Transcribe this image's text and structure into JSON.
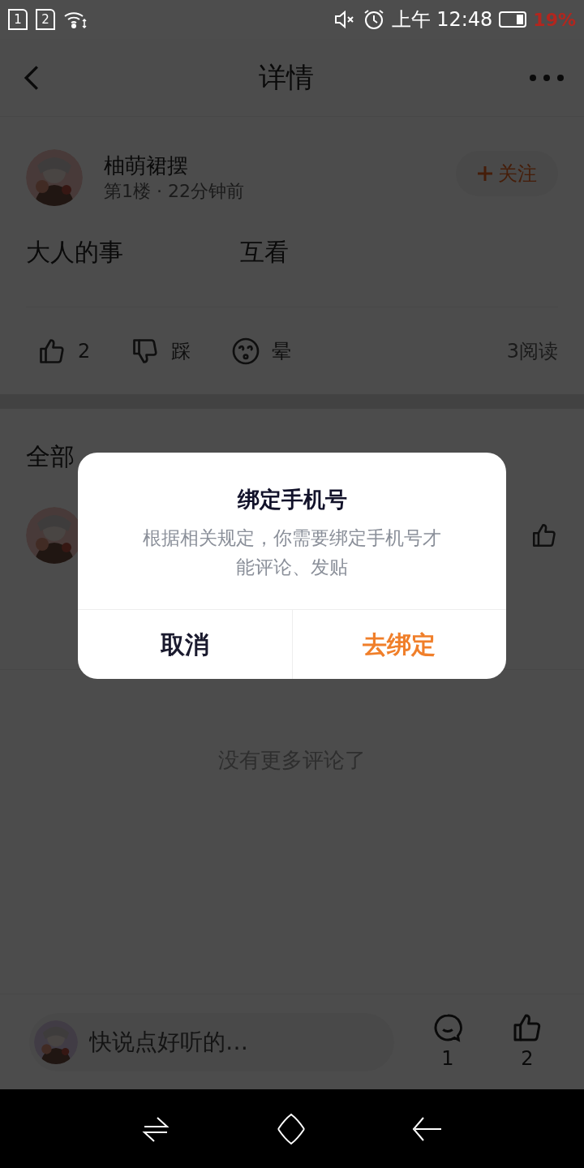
{
  "status_bar": {
    "sim_slots": [
      "1",
      "2"
    ],
    "time": "上午 12:48",
    "battery": "19%"
  },
  "header": {
    "title": "详情"
  },
  "post": {
    "author": "柚萌裙摆",
    "meta": "第1楼 · 22分钟前",
    "follow_button": "关注",
    "content": [
      "大人的事",
      "互看"
    ],
    "reactions": [
      {
        "kind": "like",
        "label": "2"
      },
      {
        "kind": "dislike",
        "label": "踩"
      },
      {
        "kind": "dizzy",
        "label": "晕"
      }
    ],
    "reads": "3阅读"
  },
  "comments": {
    "heading": "全部"
  },
  "end_note": "没有更多评论了",
  "input_bar": {
    "placeholder": "快说点好听的…",
    "comment_count": "1",
    "like_count": "2"
  },
  "dialog": {
    "title": "绑定手机号",
    "message": "根据相关规定，你需要绑定手机号才能评论、发贴",
    "buttons": [
      {
        "label": "取消",
        "kind": "cancel"
      },
      {
        "label": "去绑定",
        "kind": "confirm"
      }
    ]
  }
}
